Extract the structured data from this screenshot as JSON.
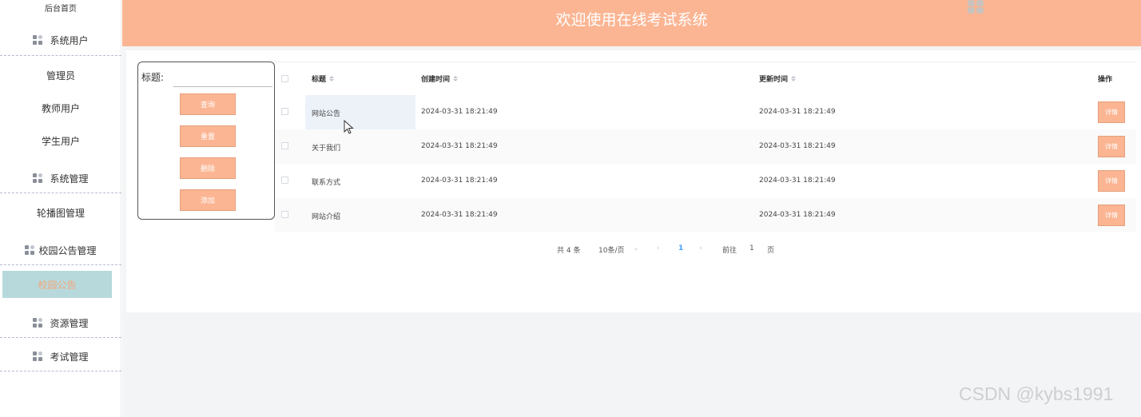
{
  "sidebar": {
    "home": "后台首页",
    "group_system_users": "系统用户",
    "admin": "管理员",
    "teacher_users": "教师用户",
    "student_users": "学生用户",
    "group_system_mgmt": "系统管理",
    "carousel_mgmt": "轮播图管理",
    "group_campus_notice": "校园公告管理",
    "campus_notice": "校园公告",
    "group_resource": "资源管理",
    "group_exam": "考试管理"
  },
  "header": {
    "title": "欢迎使用在线考试系统"
  },
  "search": {
    "label": "标题:",
    "value": "",
    "btn_query": "查询",
    "btn_reset": "重置",
    "btn_delete": "删除",
    "btn_add": "添加"
  },
  "table": {
    "columns": {
      "title": "标题",
      "created": "创建时间",
      "updated": "更新时间",
      "action": "操作"
    },
    "rows": [
      {
        "title": "网站公告",
        "created": "2024-03-31 18:21:49",
        "updated": "2024-03-31 18:21:49",
        "action": "详情"
      },
      {
        "title": "关于我们",
        "created": "2024-03-31 18:21:49",
        "updated": "2024-03-31 18:21:49",
        "action": "详情"
      },
      {
        "title": "联系方式",
        "created": "2024-03-31 18:21:49",
        "updated": "2024-03-31 18:21:49",
        "action": "详情"
      },
      {
        "title": "网站介绍",
        "created": "2024-03-31 18:21:49",
        "updated": "2024-03-31 18:21:49",
        "action": "详情"
      }
    ]
  },
  "pagination": {
    "total": "共 4 条",
    "page_size": "10条/页",
    "current": "1",
    "goto_label": "前往",
    "goto_value": "1",
    "page_suffix": "页"
  },
  "watermark": "CSDN @kybs1991",
  "colors": {
    "accent": "#fbb593",
    "active_bg": "#b7d9dc",
    "active_text": "#f5a77a"
  }
}
